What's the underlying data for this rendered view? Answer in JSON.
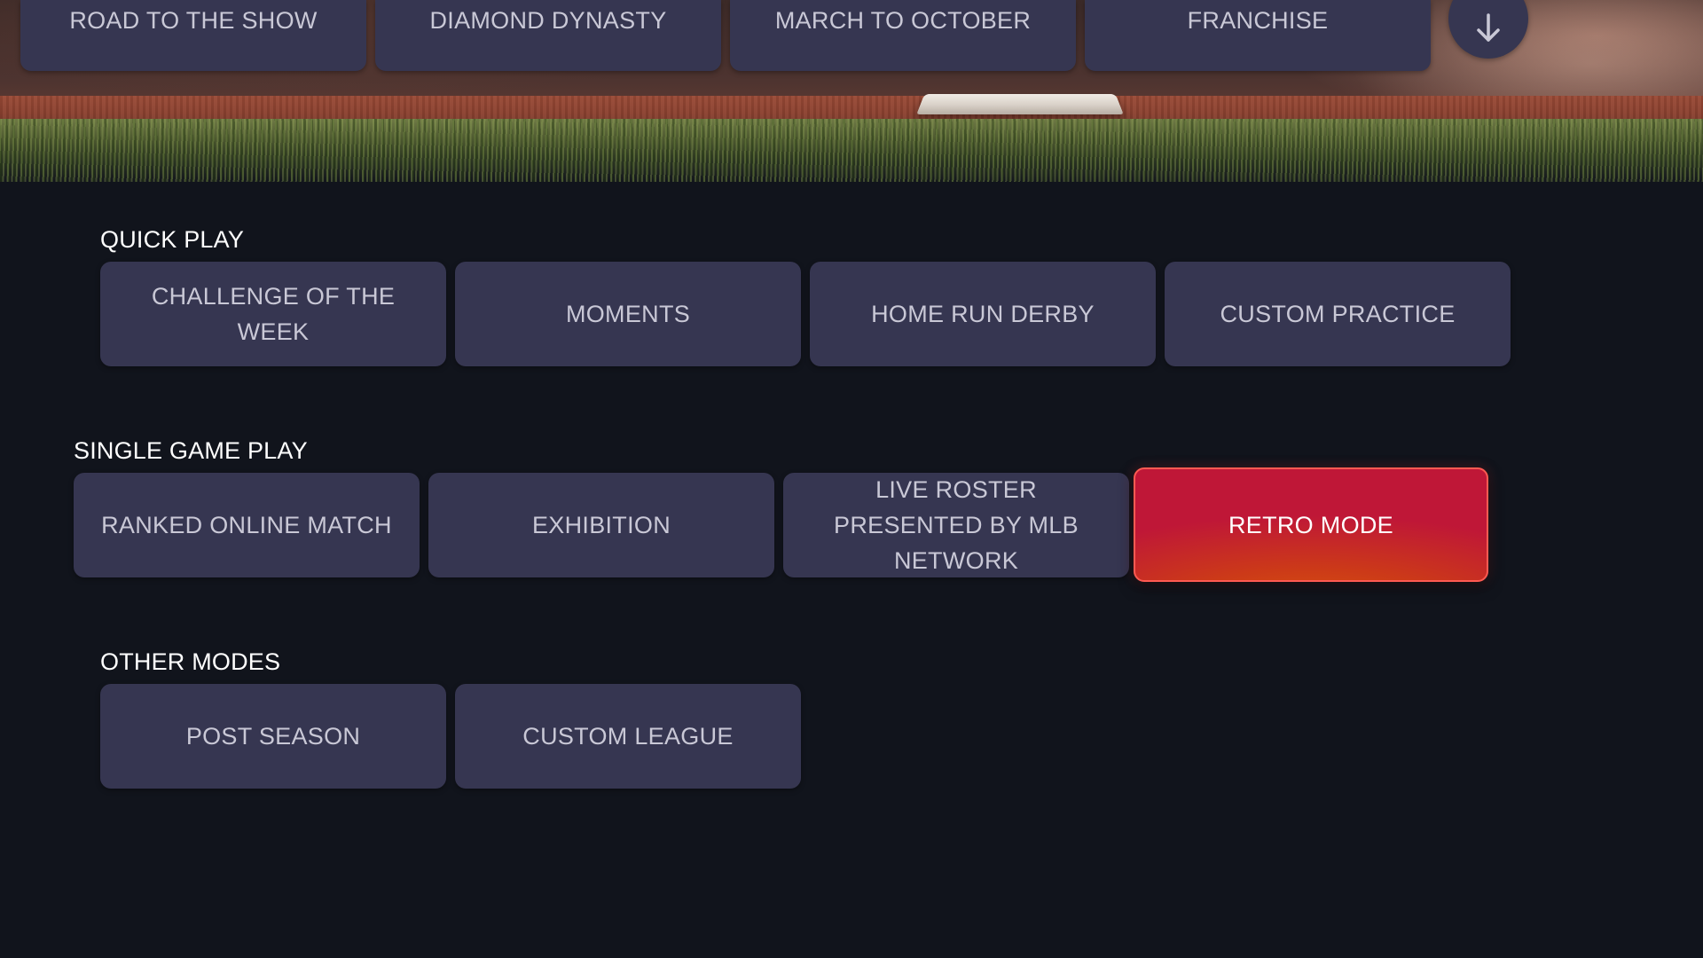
{
  "top_nav": {
    "tabs": [
      {
        "label": "ROAD TO THE SHOW"
      },
      {
        "label": "DIAMOND DYNASTY"
      },
      {
        "label": "MARCH TO OCTOBER"
      },
      {
        "label": "FRANCHISE"
      }
    ],
    "scroll_icon": "arrow-down-icon"
  },
  "sections": {
    "quick_play": {
      "title": "QUICK PLAY",
      "items": [
        {
          "label": "CHALLENGE OF THE WEEK"
        },
        {
          "label": "MOMENTS"
        },
        {
          "label": "HOME RUN DERBY"
        },
        {
          "label": "CUSTOM PRACTICE"
        }
      ]
    },
    "single_game_play": {
      "title": "SINGLE GAME PLAY",
      "items": [
        {
          "label": "RANKED ONLINE MATCH"
        },
        {
          "label": "EXHIBITION"
        },
        {
          "label": "LIVE ROSTER PRESENTED BY MLB NETWORK"
        },
        {
          "label": "RETRO MODE",
          "selected": true
        }
      ]
    },
    "other_modes": {
      "title": "OTHER MODES",
      "items": [
        {
          "label": "POST SEASON"
        },
        {
          "label": "CUSTOM LEAGUE"
        }
      ]
    }
  },
  "colors": {
    "background": "#11141c",
    "tile": "#363651",
    "tile_text": "#c9c8d6",
    "selected_start": "#bf1737",
    "selected_end": "#d9580d",
    "section_title": "#ffffff"
  }
}
